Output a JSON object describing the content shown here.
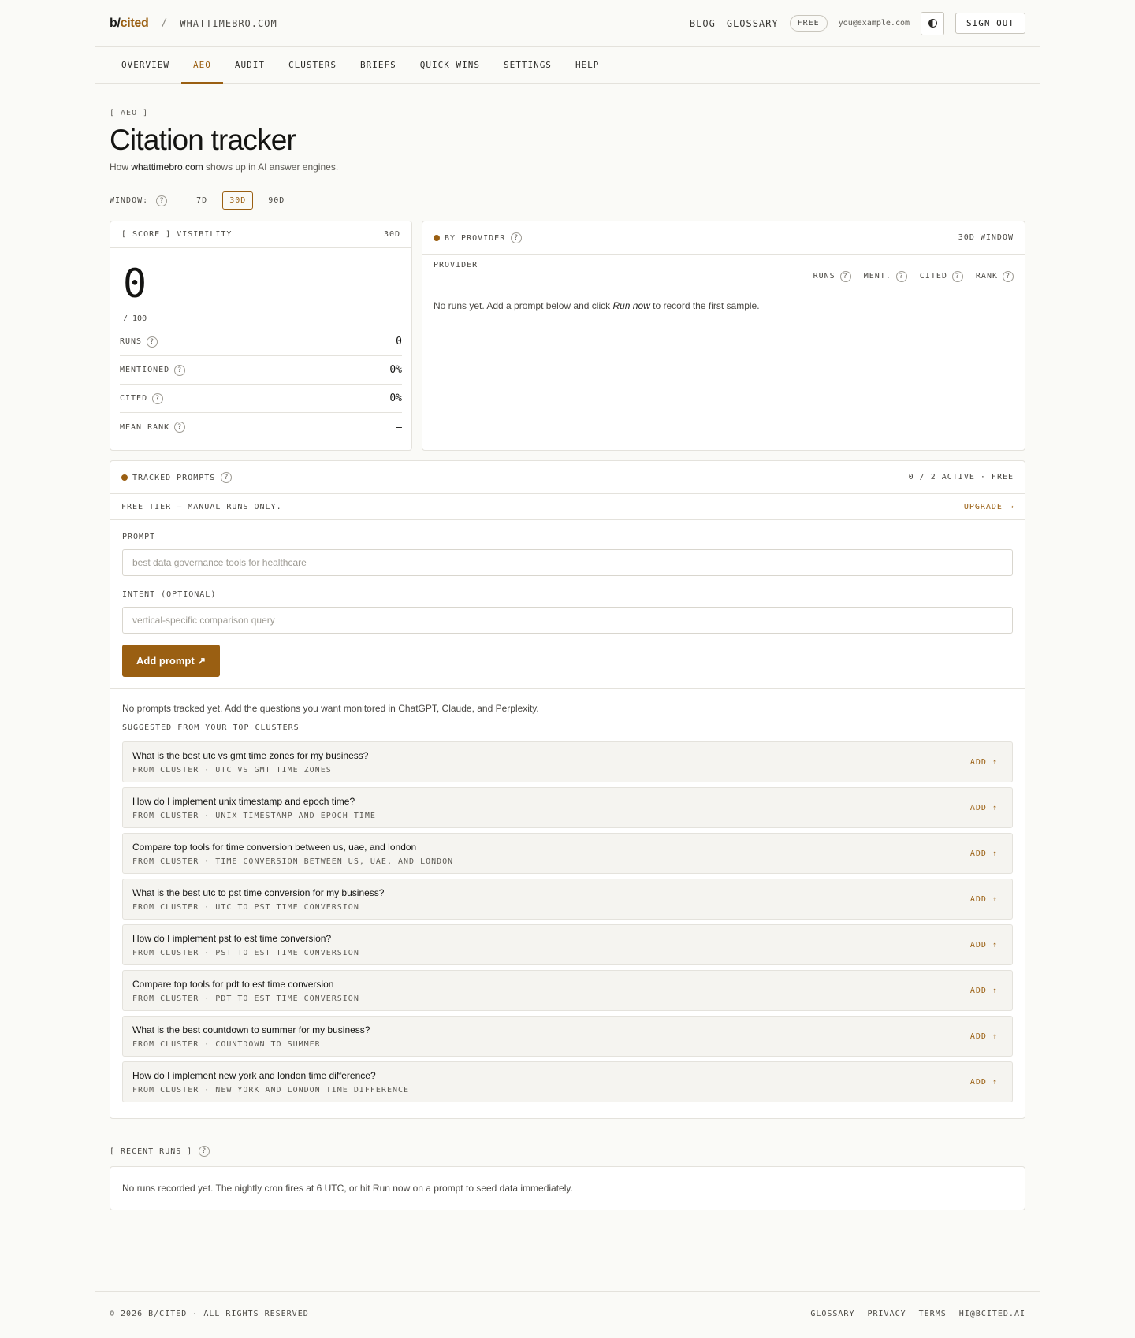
{
  "header": {
    "logo_prefix": "b/",
    "logo_name": "cited",
    "separator": "/",
    "site": "WHATTIMEBRO.COM",
    "blog": "BLOG",
    "glossary": "GLOSSARY",
    "plan_badge": "FREE",
    "email": "you@example.com",
    "sign_out": "SIGN OUT"
  },
  "tabs": [
    {
      "label": "OVERVIEW"
    },
    {
      "label": "AEO"
    },
    {
      "label": "AUDIT"
    },
    {
      "label": "CLUSTERS"
    },
    {
      "label": "BRIEFS"
    },
    {
      "label": "QUICK WINS"
    },
    {
      "label": "SETTINGS"
    },
    {
      "label": "HELP"
    }
  ],
  "page": {
    "eyebrow": "[ AEO ]",
    "title": "Citation tracker",
    "subtitle_pre": "How ",
    "subtitle_domain": "whattimebro.com",
    "subtitle_post": " shows up in AI answer engines.",
    "window_label": "WINDOW:",
    "window_options": [
      "7D",
      "30D",
      "90D"
    ]
  },
  "score": {
    "head_left": "[ SCORE ] VISIBILITY",
    "head_right": "30D",
    "value": "0",
    "out_of": "/ 100",
    "metrics": [
      {
        "label": "RUNS",
        "value": "0"
      },
      {
        "label": "MENTIONED",
        "value": "0%"
      },
      {
        "label": "CITED",
        "value": "0%"
      },
      {
        "label": "MEAN RANK",
        "value": "—"
      }
    ]
  },
  "provider": {
    "title": "BY PROVIDER",
    "window": "30D WINDOW",
    "col_provider": "PROVIDER",
    "cols": [
      "RUNS",
      "MENT.",
      "CITED",
      "RANK"
    ],
    "empty_pre": "No runs yet. Add a prompt below and click ",
    "empty_em": "Run now",
    "empty_post": " to record the first sample."
  },
  "prompts": {
    "title": "TRACKED PROMPTS",
    "status": "0 / 2 ACTIVE · FREE",
    "tier_note": "FREE TIER — MANUAL RUNS ONLY.",
    "upgrade": "UPGRADE ⟶",
    "prompt_label": "PROMPT",
    "prompt_placeholder": "best data governance tools for healthcare",
    "intent_label": "INTENT (OPTIONAL)",
    "intent_placeholder": "vertical-specific comparison query",
    "add_button": "Add prompt ↗",
    "empty": "No prompts tracked yet. Add the questions you want monitored in ChatGPT, Claude, and Perplexity.",
    "suggested_label": "SUGGESTED FROM YOUR TOP CLUSTERS",
    "add_label": "ADD ↑",
    "suggestions": [
      {
        "question": "What is the best utc vs gmt time zones for my business?",
        "cluster": "FROM CLUSTER · UTC VS GMT TIME ZONES"
      },
      {
        "question": "How do I implement unix timestamp and epoch time?",
        "cluster": "FROM CLUSTER · UNIX TIMESTAMP AND EPOCH TIME"
      },
      {
        "question": "Compare top tools for time conversion between us, uae, and london",
        "cluster": "FROM CLUSTER · TIME CONVERSION BETWEEN US, UAE, AND LONDON"
      },
      {
        "question": "What is the best utc to pst time conversion for my business?",
        "cluster": "FROM CLUSTER · UTC TO PST TIME CONVERSION"
      },
      {
        "question": "How do I implement pst to est time conversion?",
        "cluster": "FROM CLUSTER · PST TO EST TIME CONVERSION"
      },
      {
        "question": "Compare top tools for pdt to est time conversion",
        "cluster": "FROM CLUSTER · PDT TO EST TIME CONVERSION"
      },
      {
        "question": "What is the best countdown to summer for my business?",
        "cluster": "FROM CLUSTER · COUNTDOWN TO SUMMER"
      },
      {
        "question": "How do I implement new york and london time difference?",
        "cluster": "FROM CLUSTER · NEW YORK AND LONDON TIME DIFFERENCE"
      }
    ]
  },
  "recent": {
    "label": "[ RECENT RUNS ]",
    "empty": "No runs recorded yet. The nightly cron fires at 6 UTC, or hit Run now on a prompt to seed data immediately."
  },
  "footer": {
    "copyright": "© 2026 B/CITED · ALL RIGHTS RESERVED",
    "links": [
      "GLOSSARY",
      "PRIVACY",
      "TERMS",
      "HI@BCITED.AI"
    ]
  },
  "colors": {
    "accent": "#9a5f12",
    "background": "#fafaf7",
    "border": "#e4e2dc"
  }
}
